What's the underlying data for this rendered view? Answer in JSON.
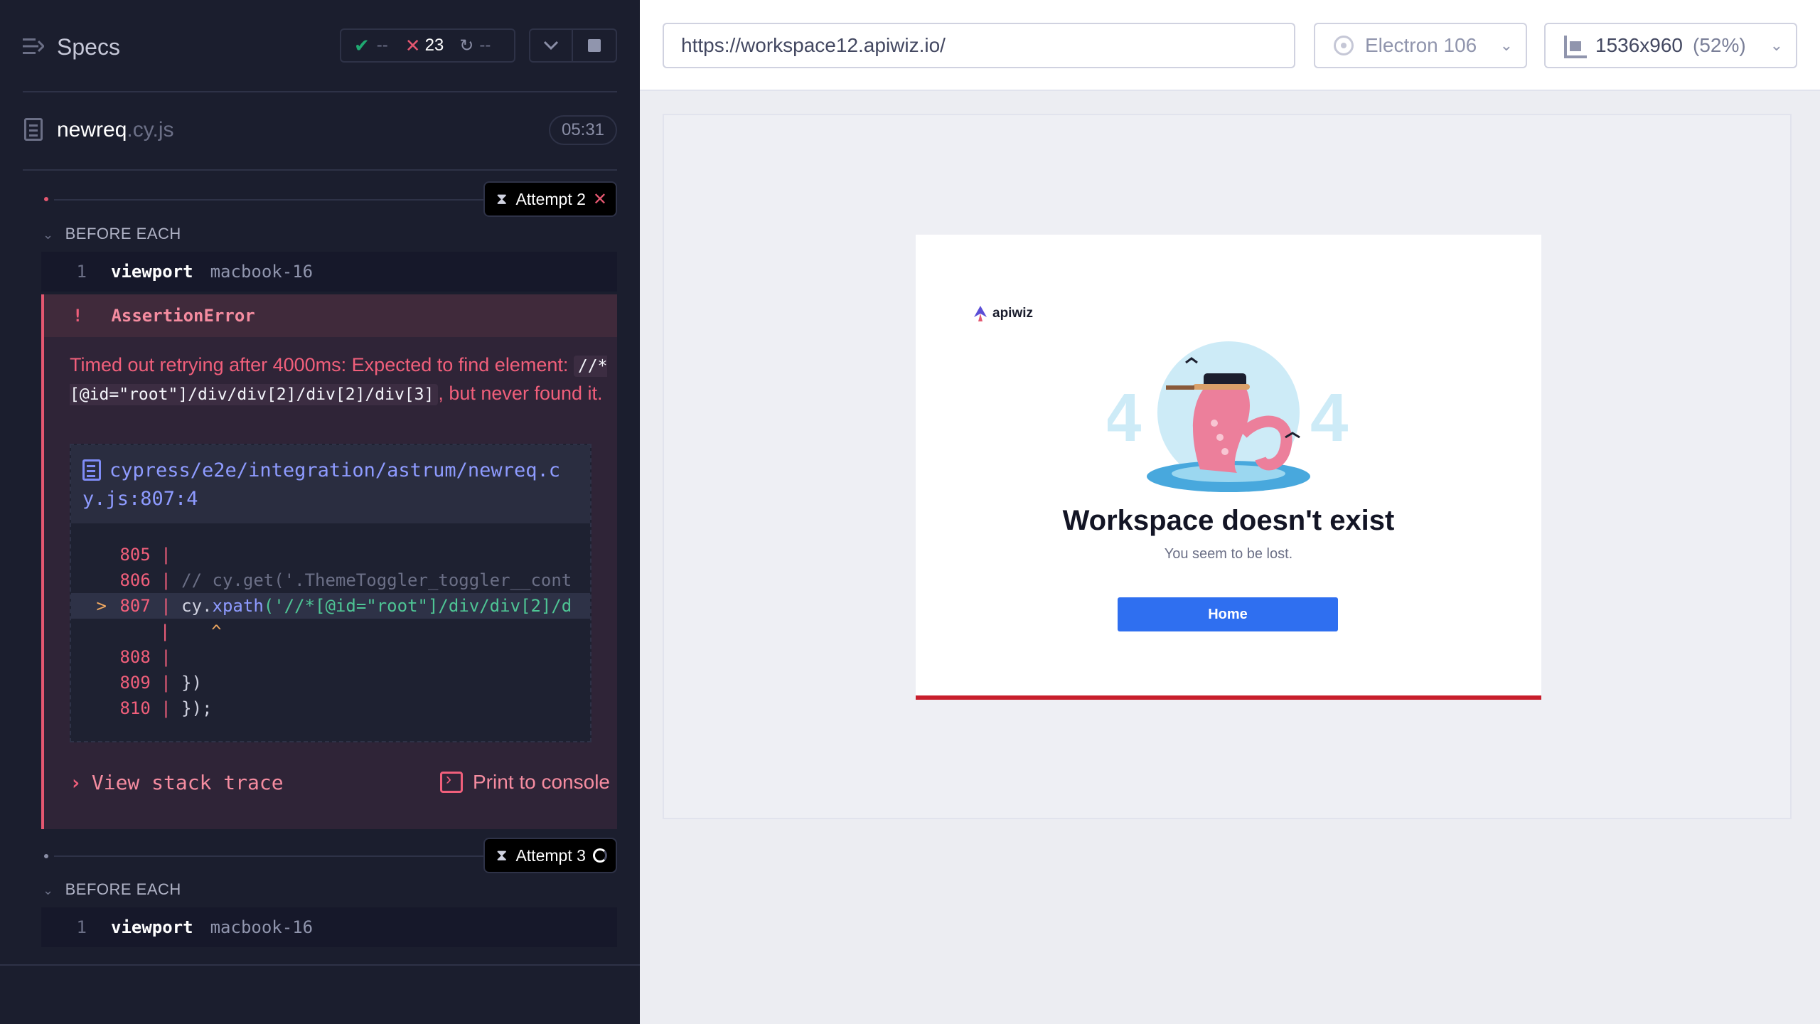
{
  "reporter": {
    "header": {
      "specs_label": "Specs",
      "stats": {
        "passed": "--",
        "failed": "23",
        "pending": "--"
      }
    },
    "spec": {
      "name": "newreq",
      "ext": ".cy.js",
      "duration": "05:31"
    },
    "attempts": [
      {
        "label": "Attempt 2",
        "state": "failed"
      },
      {
        "label": "Attempt 3",
        "state": "running"
      }
    ],
    "hooks": {
      "before_each": "BEFORE EACH"
    },
    "commands": [
      {
        "num": "1",
        "name": "viewport",
        "arg": "macbook-16"
      },
      {
        "num": "1",
        "name": "viewport",
        "arg": "macbook-16"
      }
    ],
    "error": {
      "bang": "!",
      "name": "AssertionError",
      "msg_part1": "Timed out retrying after 4000ms: Expected to find element: ",
      "msg_code": "//*[@id=\"root\"]/div/div[2]/div[2]/div[3]",
      "msg_part2": ", but never found it.",
      "file_path": "cypress/e2e/integration/astrum/newreq.cy.js:807:4",
      "code_lines": [
        {
          "marker": "",
          "num": "805",
          "text": ""
        },
        {
          "marker": "",
          "num": "806",
          "text": "// cy.get('.ThemeToggler_toggler__cont"
        },
        {
          "marker": ">",
          "num": "807",
          "pre": "cy.",
          "fn": "xpath",
          "str": "('//*[@id=\"root\"]/div/div[2]/d"
        },
        {
          "marker": "",
          "num": "",
          "caret": "   ^"
        },
        {
          "marker": "",
          "num": "808",
          "text": ""
        },
        {
          "marker": "",
          "num": "809",
          "text": "})"
        },
        {
          "marker": "",
          "num": "810",
          "text": "});"
        }
      ],
      "view_stack_trace": "View stack trace",
      "print_to_console": "Print to console"
    }
  },
  "topbar": {
    "url": "https://workspace12.apiwiz.io/",
    "browser": "Electron 106",
    "viewport": "1536x960",
    "scale": "(52%)"
  },
  "aut": {
    "brand": "apiwiz",
    "illustration_digits": [
      "4",
      "4"
    ],
    "title": "Workspace doesn't exist",
    "subtitle": "You seem to be lost.",
    "home_button": "Home"
  },
  "colors": {
    "reporter_bg": "#1b1e2e",
    "fail": "#e45770",
    "pass": "#1fa971",
    "link": "#8e9bff",
    "home_button": "#2f6ff0",
    "card_border": "#c81e2c"
  }
}
